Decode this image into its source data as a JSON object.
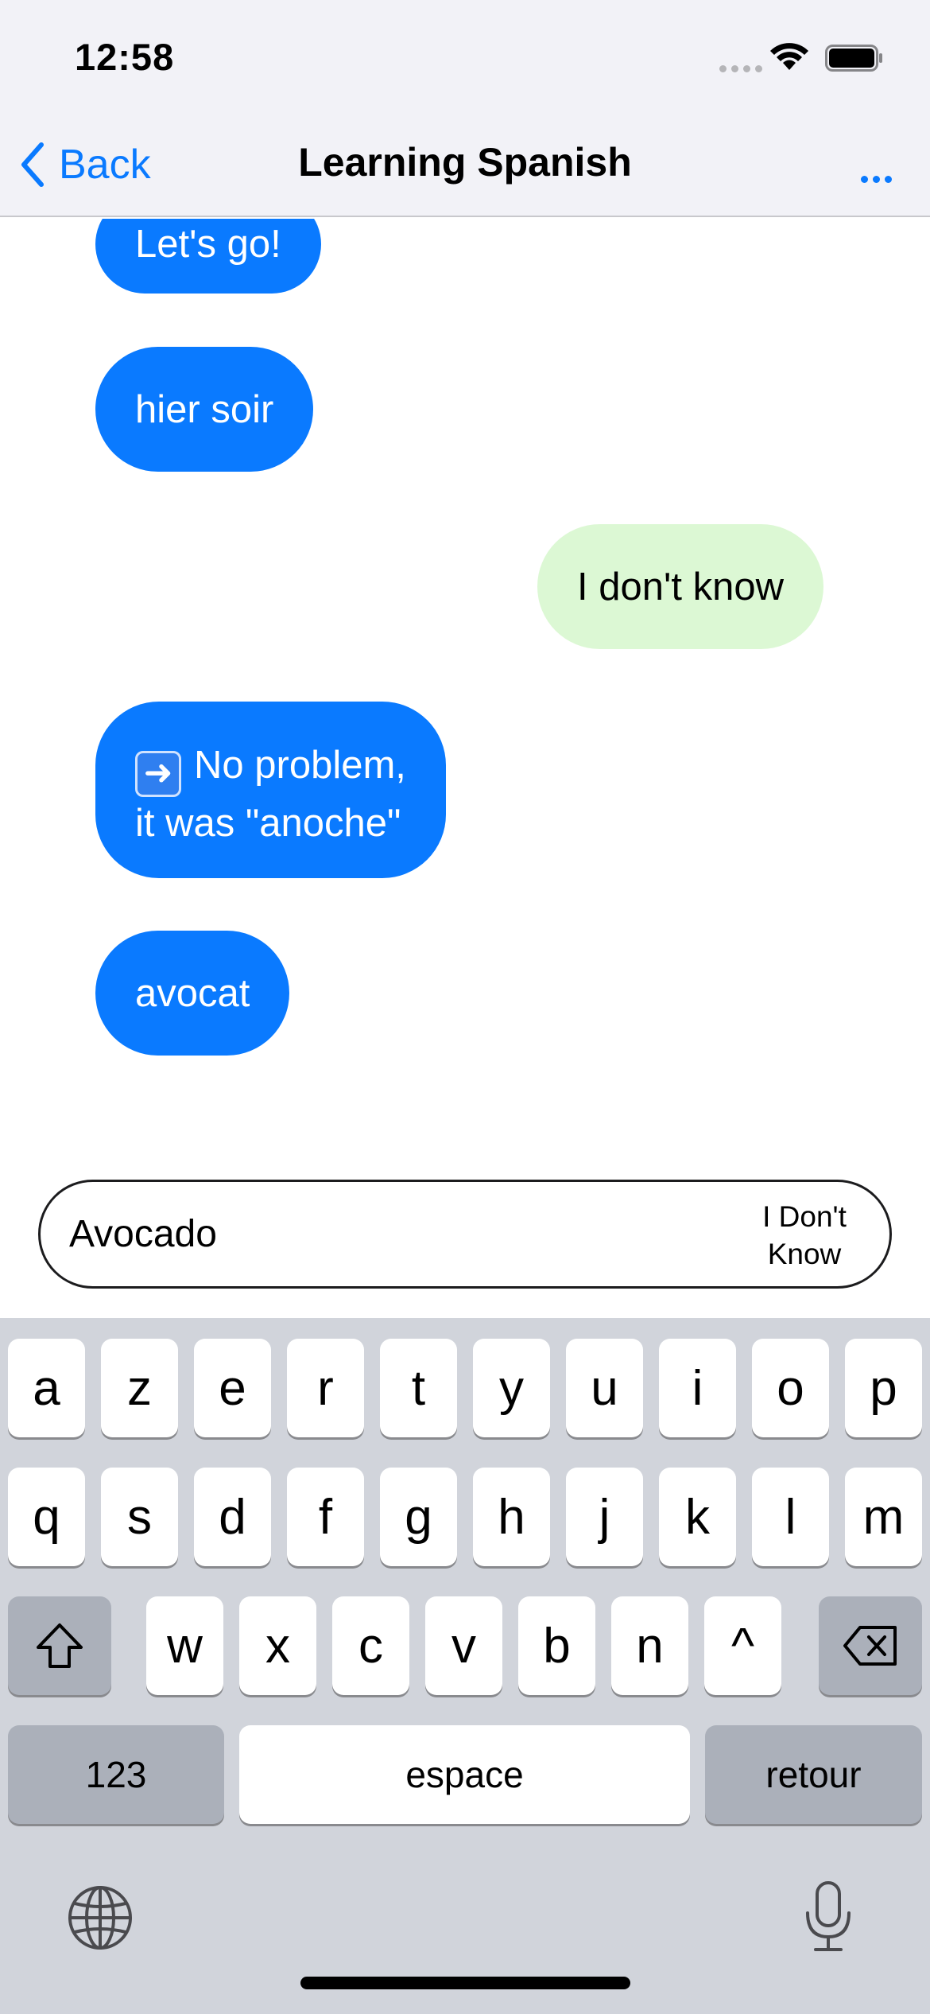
{
  "status_bar": {
    "time": "12:58"
  },
  "nav": {
    "back_label": "Back",
    "title": "Learning Spanish"
  },
  "messages": [
    {
      "from": "bot",
      "text": "Let's go!"
    },
    {
      "from": "bot",
      "text": "hier soir"
    },
    {
      "from": "user",
      "text": "I don't know"
    },
    {
      "from": "bot",
      "line1": "No problem,",
      "line2": "it was \"anoche\""
    },
    {
      "from": "bot",
      "text": "avocat"
    }
  ],
  "input": {
    "value": "Avocado",
    "dont_know_line1": "I Don't",
    "dont_know_line2": "Know"
  },
  "keyboard": {
    "row1": [
      "a",
      "z",
      "e",
      "r",
      "t",
      "y",
      "u",
      "i",
      "o",
      "p"
    ],
    "row2": [
      "q",
      "s",
      "d",
      "f",
      "g",
      "h",
      "j",
      "k",
      "l",
      "m"
    ],
    "row3": [
      "w",
      "x",
      "c",
      "v",
      "b",
      "n",
      "^"
    ],
    "numbers": "123",
    "space": "espace",
    "return": "retour"
  },
  "colors": {
    "accent": "#0a7aff",
    "bot_bubble": "#0a7aff",
    "user_bubble": "#dcf8d4",
    "keyboard_bg": "#d1d4db"
  }
}
